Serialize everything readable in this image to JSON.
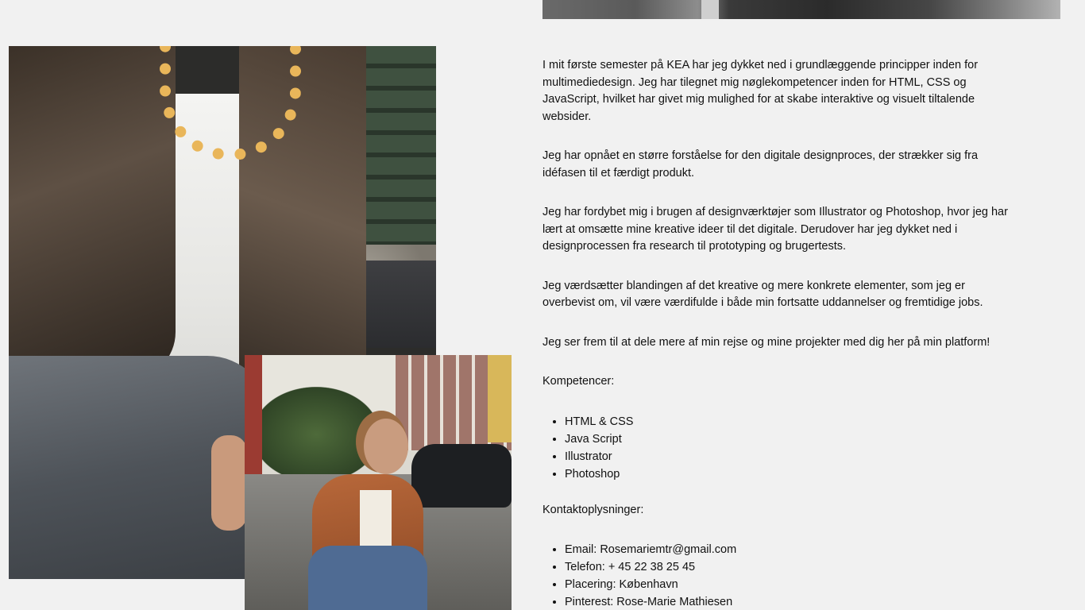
{
  "about": {
    "paragraphs": [
      "I mit første semester på KEA har jeg dykket ned i grundlæggende principper inden for multimediedesign. Jeg har tilegnet mig nøglekompetencer inden for HTML, CSS og JavaScript, hvilket har givet mig mulighed for at skabe interaktive og visuelt tiltalende websider.",
      "Jeg har opnået en større forståelse for den digitale designproces, der strækker sig fra idéfasen til et færdigt produkt.",
      "Jeg har fordybet mig i brugen af designværktøjer som Illustrator og Photoshop, hvor jeg har lært at omsætte mine kreative ideer til det digitale. Derudover har jeg dykket ned i designprocessen fra research til prototyping og brugertests.",
      "Jeg værdsætter blandingen af det kreative og mere konkrete elementer, som jeg er overbevist om, vil være værdifulde i både min fortsatte uddannelser og fremtidige jobs.",
      "Jeg ser frem til at dele mere af min rejse og mine projekter med dig her på min platform!"
    ]
  },
  "competences": {
    "heading": "Kompetencer:",
    "items": [
      "HTML & CSS",
      "Java Script",
      "Illustrator",
      "Photoshop"
    ]
  },
  "contact": {
    "heading": "Kontaktoplysninger:",
    "items": [
      "Email: Rosemariemtr@gmail.com",
      "Telefon: + 45 22 38 25 45",
      "Placering: København",
      "Pinterest: Rose-Marie Mathiesen"
    ]
  }
}
